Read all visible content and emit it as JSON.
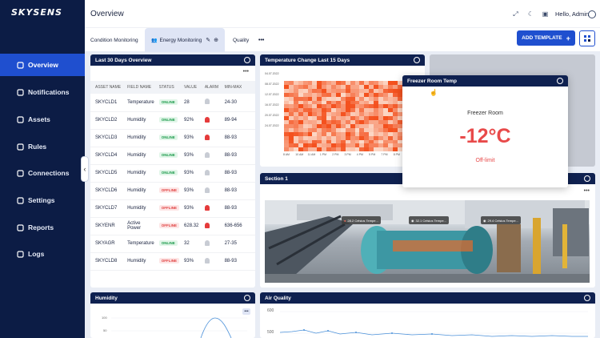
{
  "brand": "SKYSENS",
  "sidebar": {
    "items": [
      {
        "label": "Overview",
        "icon": "grid-icon"
      },
      {
        "label": "Notifications",
        "icon": "bell-icon"
      },
      {
        "label": "Assets",
        "icon": "cube-icon"
      },
      {
        "label": "Rules",
        "icon": "flow-icon"
      },
      {
        "label": "Connections",
        "icon": "folder-icon"
      },
      {
        "label": "Settings",
        "icon": "gear-icon"
      },
      {
        "label": "Reports",
        "icon": "chart-icon"
      },
      {
        "label": "Logs",
        "icon": "document-icon"
      }
    ]
  },
  "header": {
    "title": "Overview",
    "greeting": "Hello, Admin"
  },
  "tabs": {
    "condition": "Condition Monitoring",
    "energy": "Energy Monitoring",
    "quality": "Quality",
    "more": "•••",
    "add_template": "ADD TEMPLATE"
  },
  "overview": {
    "title": "Last 30 Days Overview",
    "more": "•••",
    "headers": [
      "ASSET NAME",
      "FIELD NAME",
      "STATUS",
      "VALUE",
      "ALARM",
      "MIN-MAX"
    ],
    "rows": [
      {
        "asset": "SKYCLD1",
        "field": "Temperature",
        "status": "ONLINE",
        "value": "28",
        "alarm": "grey",
        "range": "24-30"
      },
      {
        "asset": "SKYCLD2",
        "field": "Humidity",
        "status": "ONLINE",
        "value": "92%",
        "alarm": "red",
        "range": "89-94"
      },
      {
        "asset": "SKYCLD3",
        "field": "Humidity",
        "status": "ONLINE",
        "value": "93%",
        "alarm": "red",
        "range": "88-93"
      },
      {
        "asset": "SKYCLD4",
        "field": "Humidity",
        "status": "ONLINE",
        "value": "93%",
        "alarm": "grey",
        "range": "88-93"
      },
      {
        "asset": "SKYCLD5",
        "field": "Humidity",
        "status": "ONLINE",
        "value": "93%",
        "alarm": "grey",
        "range": "88-93"
      },
      {
        "asset": "SKYCLD6",
        "field": "Humidity",
        "status": "OFFLINE",
        "value": "93%",
        "alarm": "grey",
        "range": "88-93"
      },
      {
        "asset": "SKYCLD7",
        "field": "Humidity",
        "status": "OFFLINE",
        "value": "93%",
        "alarm": "red",
        "range": "88-93"
      },
      {
        "asset": "SKYENR",
        "field": "Active Power",
        "status": "OFFLINE",
        "value": "628.32",
        "alarm": "red",
        "range": "636-656"
      },
      {
        "asset": "SKYAGR",
        "field": "Temperature",
        "status": "ONLINE",
        "value": "32",
        "alarm": "grey",
        "range": "27-35"
      },
      {
        "asset": "SKYCLD8",
        "field": "Humidity",
        "status": "OFFLINE",
        "value": "93%",
        "alarm": "grey",
        "range": "88-93"
      }
    ]
  },
  "temp_change": {
    "title": "Temperature Change Last 15 Days",
    "dates": [
      "04.07.2022",
      "08.07.2022",
      "12.07.2022",
      "16.07.2022",
      "20.07.2022",
      "24.07.2022"
    ],
    "hours": [
      "8 AM",
      "10 AM",
      "11 AM",
      "1 PM",
      "2 PM",
      "3 PM",
      "4 PM",
      "5 PM",
      "7 PM",
      "8 PM"
    ]
  },
  "freezer": {
    "title": "Freezer Room Temp",
    "room": "Freezer Room",
    "value": "-12°C",
    "state": "Off-limit"
  },
  "section1": {
    "title": "Section 1",
    "more": "•••",
    "tags": [
      "28.2 Celsius Tempe...",
      "32.1 Celsius Tempe...",
      "29.4 Celsius Tempe..."
    ]
  },
  "humidity": {
    "title": "Humidity",
    "yticks": [
      "100",
      "50"
    ]
  },
  "air": {
    "title": "Air Quality",
    "yticks": [
      "600",
      "500"
    ]
  },
  "colors": {
    "accent": "#1f4fcf",
    "navy": "#0c1c45",
    "heat_low": "#fcd9c8",
    "heat_high": "#f4511e",
    "alarm": "#e53b3b"
  }
}
